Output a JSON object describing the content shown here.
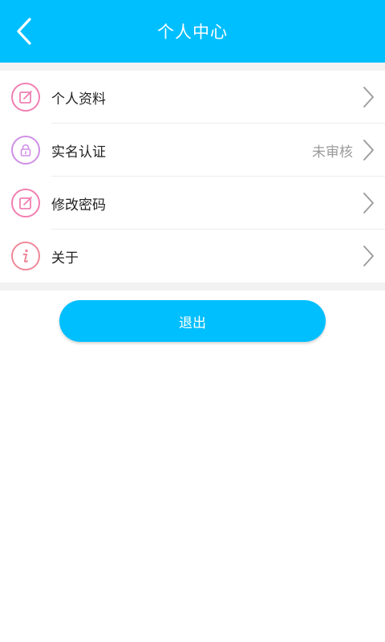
{
  "header": {
    "title": "个人中心",
    "back_icon": "back-arrow-icon"
  },
  "menu": {
    "items": [
      {
        "label": "个人资料",
        "value": "",
        "icon": "edit-icon",
        "icon_color": "#f27fb2"
      },
      {
        "label": "实名认证",
        "value": "未审核",
        "icon": "lock-icon",
        "icon_color": "#cf8fe6"
      },
      {
        "label": "修改密码",
        "value": "",
        "icon": "edit-icon",
        "icon_color": "#f27fb2"
      },
      {
        "label": "关于",
        "value": "",
        "icon": "info-icon",
        "icon_color": "#f0889a"
      }
    ]
  },
  "logout": {
    "label": "退出"
  },
  "colors": {
    "accent": "#00bfff",
    "divider": "#ececec",
    "background_gap": "#f2f2f2"
  }
}
